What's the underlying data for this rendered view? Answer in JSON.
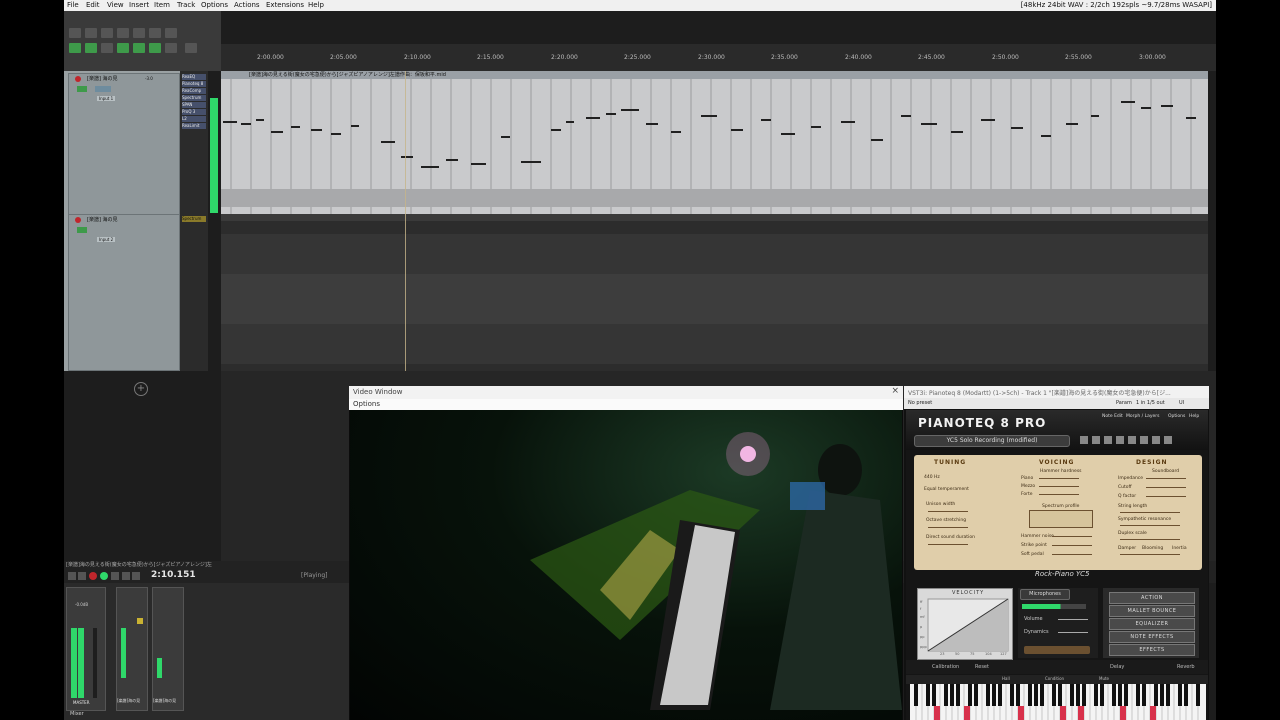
{
  "menu": {
    "items": [
      "File",
      "Edit",
      "View",
      "Insert",
      "Item",
      "Track",
      "Options",
      "Actions",
      "Extensions",
      "Help"
    ],
    "audio_status": "[48kHz 24bit WAV : 2/2ch 192spls ~9.7/28ms WASAPI]"
  },
  "ruler": {
    "ticks": [
      "2:00.000",
      "2:05.000",
      "2:10.000",
      "2:15.000",
      "2:20.000",
      "2:25.000",
      "2:30.000",
      "2:35.000",
      "2:40.000",
      "2:45.000",
      "2:50.000",
      "2:55.000",
      "3:00.000"
    ]
  },
  "tracks": [
    {
      "name": "[楽譜] 海の見",
      "number": "1",
      "volume": "-3.0",
      "input": "Input 1"
    },
    {
      "name": "[楽譜] 海の見",
      "number": "2",
      "volume": "",
      "input": "Input 2"
    }
  ],
  "fx_chain": [
    "ReaEQ",
    "Pianoteq 8",
    "ReaComp",
    "Spectrum",
    "SPAN",
    "ProQ 3",
    "L2",
    "ReaLimit"
  ],
  "fx_track2": "Spectrum M",
  "midi_item_title": "[楽譜]海の見える街(魔女の宅急便)から[ジャズピアノアレンジ]左譜作曲：保坂和平.mid",
  "transport": {
    "title": "[楽譜]海の見える街(魔女の宅急便)から[ジャズピアノアレンジ]左",
    "time": "2:10.151",
    "state": "[Playing]"
  },
  "mixer": {
    "master_label": "MASTER",
    "master_volume": "-0.0dB",
    "strip_names": [
      "[楽譜]海の見",
      "[楽譜]海の見"
    ],
    "tab": "Mixer"
  },
  "video_window": {
    "title": "Video Window",
    "menu": "Options"
  },
  "pianoteq": {
    "window_title": "VST3i: Pianoteq 8 (Modartt) (1->5ch) - Track 1 \"[楽譜]海の見える街(魔女の宅急便)から[ジ...",
    "preset_label": "No preset",
    "param_label": "Param",
    "io_label": "1 in 1/5 out",
    "ui_label": "UI",
    "menu_items": [
      "Note Edit",
      "Morph / Layers",
      "Options",
      "Help"
    ],
    "logo": "PIANOTEQ 8 PRO",
    "preset": "YC5 Solo Recording (modified)",
    "sections": {
      "tuning": "TUNING",
      "voicing": "VOICING",
      "design": "DESIGN"
    },
    "tuning_params": [
      "440 Hz",
      "Equal temperament",
      "Unison width",
      "Octave stretching",
      "Direct sound duration"
    ],
    "voicing_params": [
      "Hammer hardness",
      "Piano",
      "Mezzo",
      "Forte",
      "Spectrum profile",
      "Hammer noise",
      "Strike point",
      "Soft pedal"
    ],
    "design_params": [
      "Soundboard",
      "Impedance",
      "Cutoff",
      "Q factor",
      "String length",
      "Sympathetic resonance",
      "Duplex scale",
      "Damper",
      "Blooming",
      "Inertia"
    ],
    "brand": "Rock-Piano YC5",
    "velocity_label": "VELOCITY",
    "velocity_ticks": [
      "ppp",
      "pp",
      "p",
      "mf",
      "f",
      "ff"
    ],
    "velocity_x": [
      "23",
      "50",
      "75",
      "104",
      "127"
    ],
    "microphones": "Microphones",
    "volume_label": "Volume",
    "dynamics_label": "Dynamics",
    "actions": [
      "ACTION",
      "MALLET BOUNCE",
      "EQUALIZER",
      "NOTE EFFECTS",
      "EFFECTS"
    ],
    "footer": {
      "calibration": "Calibration",
      "reset": "Reset",
      "delay": "Delay",
      "reverb": "Reverb"
    },
    "kb_labels": [
      "Hall",
      "Condition",
      "Mute"
    ]
  }
}
